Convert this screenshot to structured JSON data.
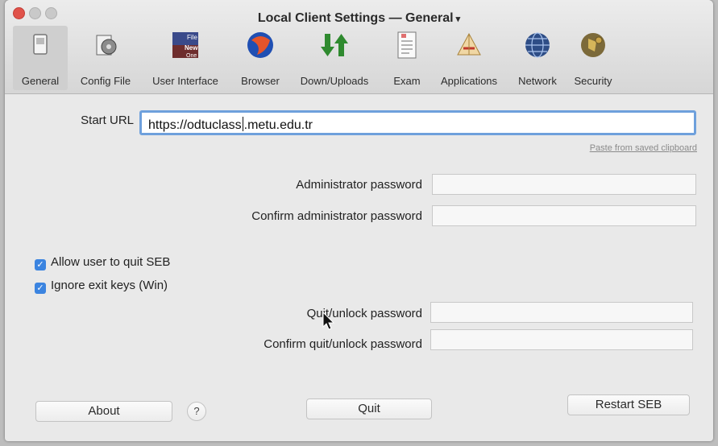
{
  "window": {
    "title": "Local Client Settings",
    "separator": "—",
    "section": "General",
    "caret": "▾"
  },
  "toolbar": {
    "items": [
      {
        "label": "General",
        "icon": "general-icon"
      },
      {
        "label": "Config File",
        "icon": "config-file-icon"
      },
      {
        "label": "User Interface",
        "icon": "user-interface-icon"
      },
      {
        "label": "Browser",
        "icon": "browser-icon"
      },
      {
        "label": "Down/Uploads",
        "icon": "down-uploads-icon"
      },
      {
        "label": "Exam",
        "icon": "exam-icon"
      },
      {
        "label": "Applications",
        "icon": "applications-icon"
      },
      {
        "label": "Network",
        "icon": "network-icon"
      },
      {
        "label": "Security",
        "icon": "security-icon"
      }
    ],
    "ui_icon_text": [
      "File",
      "New",
      "One"
    ]
  },
  "general": {
    "start_url_label": "Start URL",
    "start_url_before_cursor": "https://odtuclass",
    "start_url_after_cursor": ".metu.edu.tr",
    "paste_link": "Paste from saved clipboard",
    "admin_password_label": "Administrator password",
    "confirm_admin_password_label": "Confirm administrator password",
    "allow_quit_label": "Allow user to quit SEB",
    "allow_quit_checked": true,
    "ignore_exit_keys_label": "Ignore exit keys (Win)",
    "ignore_exit_keys_checked": true,
    "quit_password_label": "Quit/unlock password",
    "confirm_quit_password_label": "Confirm quit/unlock password"
  },
  "buttons": {
    "about": "About",
    "help": "?",
    "quit": "Quit",
    "restart": "Restart SEB"
  },
  "colors": {
    "accent": "#3b84e0",
    "focus_ring": "#6ea0dc",
    "close": "#e0524a"
  }
}
